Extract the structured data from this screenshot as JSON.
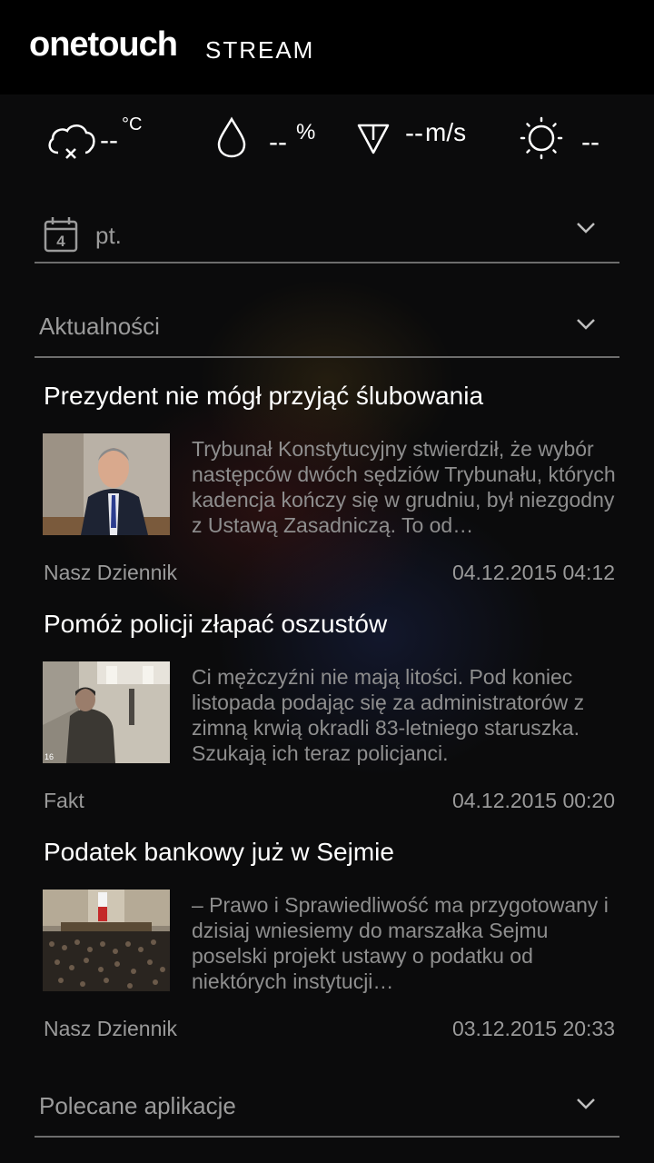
{
  "header": {
    "brand": "onetouch",
    "product": "STREAM"
  },
  "weather": {
    "temp": {
      "icon": "cloud-x-icon",
      "value": "--",
      "unit": "°C"
    },
    "humidity": {
      "icon": "drop-icon",
      "value": "--",
      "unit": "%"
    },
    "wind": {
      "icon": "wind-arrow-icon",
      "value": "--",
      "unit": "m/s"
    },
    "uv": {
      "icon": "sun-icon",
      "value": "--"
    }
  },
  "date_row": {
    "icon": "calendar-icon",
    "day_number": "4",
    "label": "pt."
  },
  "news_section": {
    "label": "Aktualności"
  },
  "news": [
    {
      "title": "Prezydent nie mógł przyjąć ślubowania",
      "excerpt": "Trybunał Konstytucyjny stwierdził, że wybór następców dwóch sędziów Trybunału, których kadencja kończy się w grudniu, był niezgodny z Ustawą Zasadniczą. To od…",
      "source": "Nasz Dziennik",
      "date": "04.12.2015 04:12"
    },
    {
      "title": "Pomóż policji złapać oszustów",
      "excerpt": "Ci mężczyźni nie mają litości. Pod koniec listopada podając się za administratorów z zimną krwią okradli 83-letniego staruszka. Szukają ich teraz policjanci.",
      "source": "Fakt",
      "date": "04.12.2015 00:20",
      "thumb_overlay": "16"
    },
    {
      "title": "Podatek bankowy już w Sejmie",
      "excerpt": "– Prawo i Sprawiedliwość ma przygotowany i dzisiaj wniesiemy do marszałka Sejmu poselski projekt ustawy o podatku od niektórych instytucji…",
      "source": "Nasz Dziennik",
      "date": "03.12.2015 20:33"
    }
  ],
  "apps_section": {
    "label": "Polecane aplikacje"
  }
}
